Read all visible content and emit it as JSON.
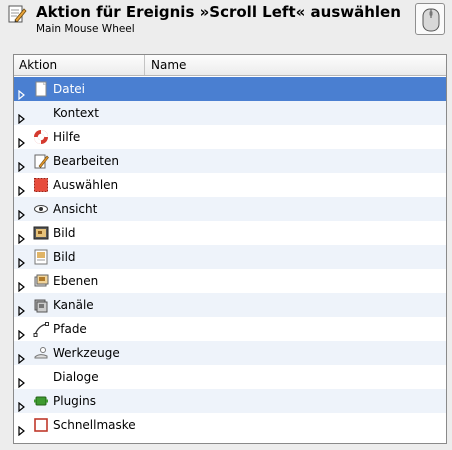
{
  "header": {
    "title": "Aktion für Ereignis »Scroll Left« auswählen",
    "subtitle": "Main Mouse Wheel"
  },
  "columns": {
    "action": "Aktion",
    "name": "Name"
  },
  "rows": [
    {
      "label": "Datei",
      "icon": "document-icon",
      "selected": true
    },
    {
      "label": "Kontext",
      "icon": ""
    },
    {
      "label": "Hilfe",
      "icon": "lifebuoy-icon"
    },
    {
      "label": "Bearbeiten",
      "icon": "edit-icon"
    },
    {
      "label": "Auswählen",
      "icon": "selection-icon"
    },
    {
      "label": "Ansicht",
      "icon": "eye-icon"
    },
    {
      "label": "Bild",
      "icon": "image-icon"
    },
    {
      "label": "Bild",
      "icon": "image-edit-icon"
    },
    {
      "label": "Ebenen",
      "icon": "layers-icon"
    },
    {
      "label": "Kanäle",
      "icon": "channels-icon"
    },
    {
      "label": "Pfade",
      "icon": "paths-icon"
    },
    {
      "label": "Werkzeuge",
      "icon": "tools-icon"
    },
    {
      "label": "Dialoge",
      "icon": ""
    },
    {
      "label": "Plugins",
      "icon": "plugin-icon"
    },
    {
      "label": "Schnellmaske",
      "icon": "quickmask-icon"
    }
  ]
}
